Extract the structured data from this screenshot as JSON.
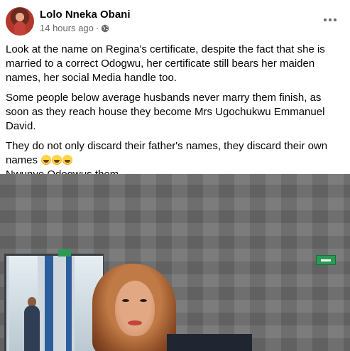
{
  "post": {
    "author": "Lolo Nneka Obani",
    "timestamp": "14 hours ago",
    "separator": "·",
    "privacy_icon": "globe-icon",
    "more_icon": "more-options-icon",
    "paragraphs": [
      "Look at the name on Regina's certificate, despite the fact that she is married to a correct Odogwu, her certificate still bears her maiden names, her social Media handle too.",
      "Some people below average husbands never marry them finish, as soon as they reach house they become Mrs Ugochukwu Emmanuel David.",
      "They do not only discard their father's names, they discard their own names"
    ],
    "emoji_count": 3,
    "emoji_name": "rolling-on-floor-laughing-icon",
    "closing_line": "Nwunye Odogwus them."
  },
  "colors": {
    "text_primary": "#050505",
    "text_secondary": "#65676b",
    "background": "#ffffff"
  }
}
